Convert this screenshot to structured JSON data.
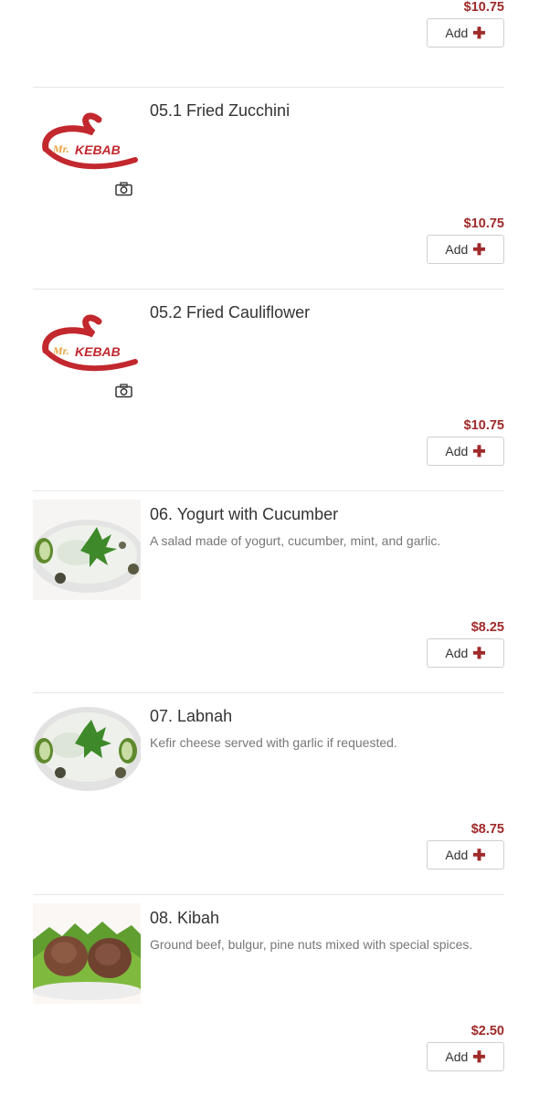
{
  "colors": {
    "price": "#a02a2a",
    "divider": "#e6e6e6"
  },
  "add_label": "Add",
  "top_item": {
    "price": "$10.75"
  },
  "items": [
    {
      "title": "05.1 Fried Zucchini",
      "description": "",
      "price": "$10.75",
      "image": "mr-kebab-logo",
      "has_camera_icon": true
    },
    {
      "title": "05.2 Fried Cauliflower",
      "description": "",
      "price": "$10.75",
      "image": "mr-kebab-logo",
      "has_camera_icon": true
    },
    {
      "title": "06. Yogurt with Cucumber",
      "description": "A salad made of yogurt, cucumber, mint, and garlic.",
      "price": "$8.25",
      "image": "yogurt-cucumber-photo",
      "has_camera_icon": false
    },
    {
      "title": "07. Labnah",
      "description": "Kefir cheese served with garlic if requested.",
      "price": "$8.75",
      "image": "labnah-photo",
      "has_camera_icon": false
    },
    {
      "title": "08. Kibah",
      "description": "Ground beef, bulgur, pine nuts mixed with special spices.",
      "price": "$2.50",
      "image": "kibah-photo",
      "has_camera_icon": false
    }
  ]
}
